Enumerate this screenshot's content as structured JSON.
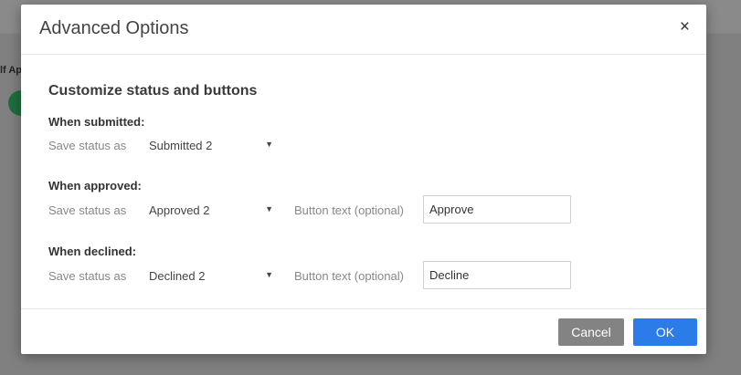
{
  "background": {
    "partial_label": "lf Ap"
  },
  "modal": {
    "title": "Advanced Options",
    "close_glyph": "×",
    "section_title": "Customize status and buttons",
    "submitted": {
      "heading": "When submitted:",
      "save_label": "Save status as",
      "status_value": "Submitted 2"
    },
    "approved": {
      "heading": "When approved:",
      "save_label": "Save status as",
      "status_value": "Approved 2",
      "button_text_label": "Button text (optional)",
      "button_text_value": "Approve"
    },
    "declined": {
      "heading": "When declined:",
      "save_label": "Save status as",
      "status_value": "Declined 2",
      "button_text_label": "Button text (optional)",
      "button_text_value": "Decline"
    },
    "footer": {
      "cancel_label": "Cancel",
      "ok_label": "OK"
    }
  },
  "icons": {
    "close": "close-icon",
    "dropdown": "caret-down-icon",
    "add": "plus-circle-icon"
  },
  "colors": {
    "ok_button": "#2b7be8",
    "cancel_button": "#838383",
    "add_button": "#1f6e3e",
    "overlay": "#7d7d7d"
  }
}
